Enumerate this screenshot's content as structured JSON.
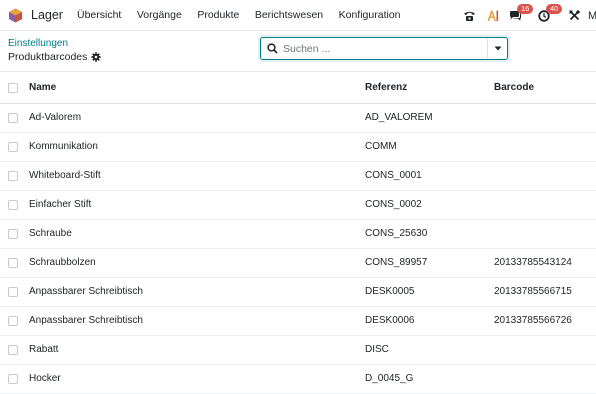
{
  "navbar": {
    "brand": "Lager",
    "menu": [
      "Übersicht",
      "Vorgänge",
      "Produkte",
      "Berichtswesen",
      "Konfiguration"
    ],
    "messages_badge": "16",
    "activities_badge": "40",
    "user_initial": "M"
  },
  "control": {
    "breadcrumb": "Einstellungen",
    "title": "Produktbarcodes",
    "search_placeholder": "Suchen ..."
  },
  "table": {
    "headers": {
      "name": "Name",
      "reference": "Referenz",
      "barcode": "Barcode"
    },
    "rows": [
      {
        "name": "Ad-Valorem",
        "reference": "AD_VALOREM",
        "barcode": ""
      },
      {
        "name": "Kommunikation",
        "reference": "COMM",
        "barcode": ""
      },
      {
        "name": "Whiteboard-Stift",
        "reference": "CONS_0001",
        "barcode": ""
      },
      {
        "name": "Einfacher Stift",
        "reference": "CONS_0002",
        "barcode": ""
      },
      {
        "name": "Schraube",
        "reference": "CONS_25630",
        "barcode": ""
      },
      {
        "name": "Schraubbolzen",
        "reference": "CONS_89957",
        "barcode": "20133785543124"
      },
      {
        "name": "Anpassbarer Schreibtisch",
        "reference": "DESK0005",
        "barcode": "20133785566715"
      },
      {
        "name": "Anpassbarer Schreibtisch",
        "reference": "DESK0006",
        "barcode": "20133785566726"
      },
      {
        "name": "Rabatt",
        "reference": "DISC",
        "barcode": ""
      },
      {
        "name": "Hocker",
        "reference": "D_0045_G",
        "barcode": ""
      }
    ]
  },
  "colors": {
    "accent": "#017e84",
    "badge": "#d9534f",
    "ai": "#e8a33d"
  }
}
